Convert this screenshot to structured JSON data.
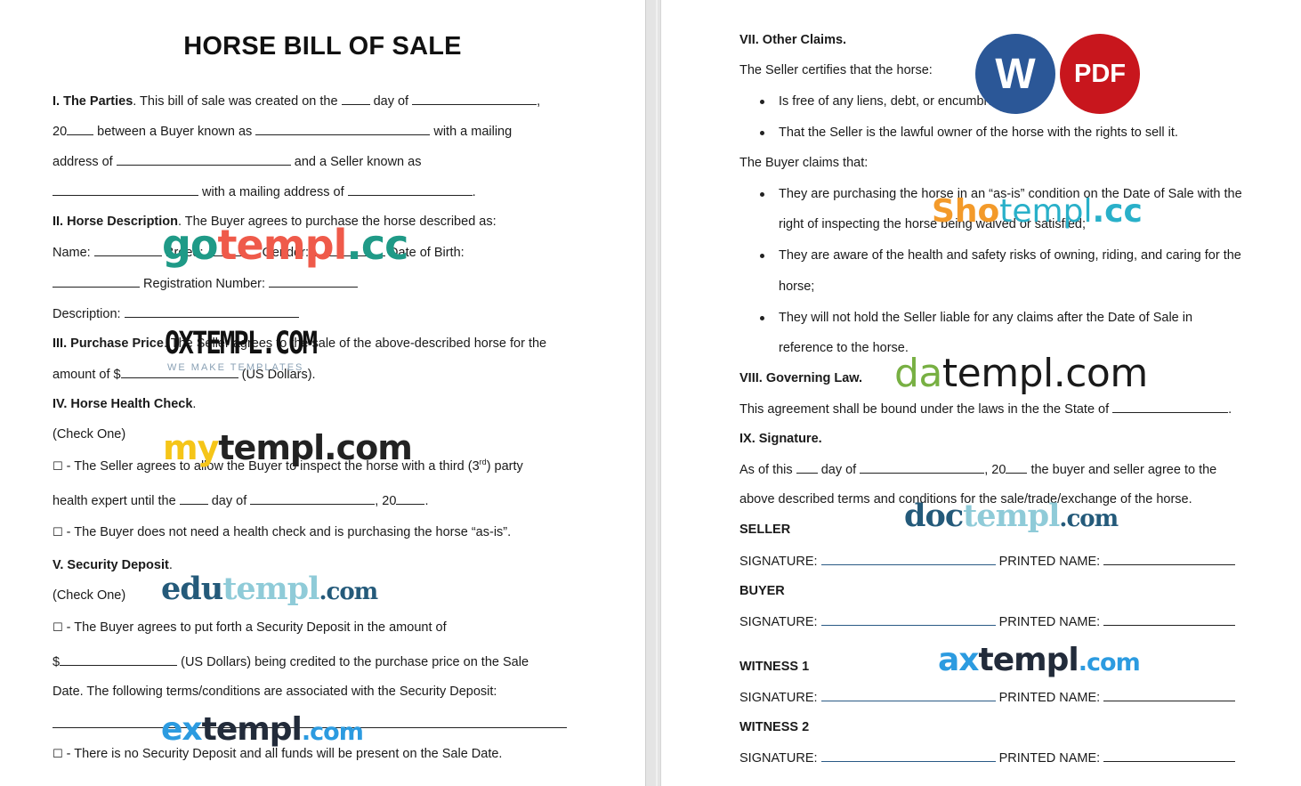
{
  "document": {
    "title": "HORSE BILL OF SALE"
  },
  "left": {
    "s1": {
      "heading": "I. The Parties",
      "l1a": ". This bill of sale was created on the",
      "l1b": "day of",
      "l1c": ",",
      "l2a": "20",
      "l2b": "between a Buyer known as",
      "l2c": "with a mailing",
      "l3a": "address of",
      "l3b": "and a Seller known as",
      "l4a": "with a mailing address of",
      "l4b": "."
    },
    "s2": {
      "heading": "II. Horse Description",
      "l1": ". The Buyer agrees to purchase the horse described as:",
      "name": "Name:",
      "breed": "Breed:",
      "gender": "Gender:",
      "dob": "Date of Birth:",
      "reg": "Registration Number:",
      "desc": "Description:"
    },
    "s3": {
      "heading": "III. Purchase Price",
      "l1": ". The Seller agrees to the sale of the above-described horse for the",
      "l2a": "amount of $",
      "l2b": "(US Dollars)."
    },
    "s4": {
      "heading": "IV. Horse Health Check",
      "dot": ".",
      "check_one": "(Check One)",
      "checkbox": "☐",
      "o1a": " - The Seller agrees to allow the Buyer to inspect the horse with a third (3",
      "o1sup": "rd",
      "o1b": ") party",
      "o1c": "health expert until the",
      "o1d": "day of",
      "o1e": ", 20",
      "o1f": ".",
      "o2": " - The Buyer does not need a health check and is purchasing the horse “as-is”."
    },
    "s5": {
      "heading": "V. Security Deposit",
      "dot": ".",
      "check_one": "(Check One)",
      "checkbox": "☐",
      "o1a": " - The Buyer agrees to put forth a Security Deposit in the amount of",
      "o1b": "$",
      "o1c": "(US Dollars) being credited to the purchase price on the Sale",
      "o1d": "Date. The following terms/conditions are associated with the Security Deposit:",
      "o2": " - There is no Security Deposit and all funds will be present on the Sale Date."
    }
  },
  "right": {
    "s7": {
      "heading": "VII. Other Claims.",
      "seller_intro": "The Seller certifies that the horse:",
      "seller_items": [
        "Is free of any liens, debt, or encumbrances;",
        "That the Seller is the lawful owner of the horse with the rights to sell it."
      ],
      "buyer_intro": "The Buyer claims that:",
      "buyer_items": [
        [
          "They are purchasing the horse in an “as-is” condition on the Date of Sale with the",
          "right of inspecting the horse being waived or satisfied;"
        ],
        [
          "They are aware of the health and safety risks of owning, riding, and caring for the",
          "horse;"
        ],
        [
          "They will not hold the Seller liable for any claims after the Date of Sale in",
          "reference to the horse."
        ]
      ]
    },
    "s8": {
      "heading": "VIII. Governing Law.",
      "l1": "This agreement shall be bound under the laws in the the State of",
      "end": "."
    },
    "s9": {
      "heading": "IX. Signature.",
      "l1a": "As of this",
      "l1b": "day of",
      "l1c": ", 20",
      "l1d": "the buyer and seller agree to the",
      "l2": "above described terms and conditions for the sale/trade/exchange of the horse."
    },
    "signatures": [
      {
        "party": "SELLER",
        "sig_label": "SIGNATURE:",
        "name_label": "PRINTED NAME:"
      },
      {
        "party": "BUYER",
        "sig_label": "SIGNATURE:",
        "name_label": "PRINTED NAME:"
      },
      {
        "party": "WITNESS 1",
        "sig_label": "SIGNATURE:",
        "name_label": "PRINTED NAME:"
      },
      {
        "party": "WITNESS 2",
        "sig_label": "SIGNATURE:",
        "name_label": "PRINTED NAME:"
      }
    ]
  },
  "badges": {
    "word": "W",
    "pdf": "PDF",
    "word_color": "#2b5797",
    "pdf_color": "#c8161d"
  },
  "watermarks": {
    "gotempl": [
      "go",
      "templ",
      ".cc"
    ],
    "oxtempl": [
      "OXTEMPL.COM",
      "WE MAKE TEMPLATES"
    ],
    "mytempl": [
      "my",
      "templ.com"
    ],
    "edutempl": [
      "edu",
      "templ",
      ".com"
    ],
    "extempl": [
      "ex",
      "templ",
      ".com"
    ],
    "shotempl": [
      "Sho",
      "templ",
      ".cc"
    ],
    "datempl": [
      "da",
      "templ.com"
    ],
    "doctempl": [
      "doc",
      "templ",
      ".com"
    ],
    "axtempl": [
      "ax",
      "templ",
      ".com"
    ]
  }
}
